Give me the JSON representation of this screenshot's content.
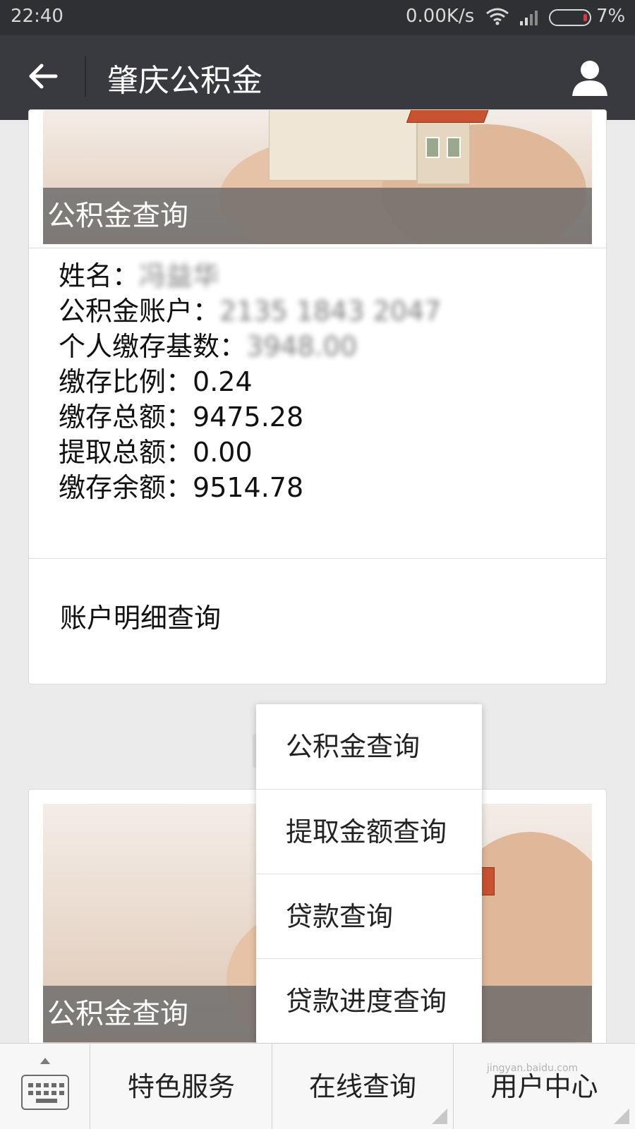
{
  "status_bar": {
    "time": "22:40",
    "network_speed": "0.00K/s",
    "battery_percent": "7%",
    "battery_level": 0.07,
    "wifi_icon": "wifi-icon",
    "signal_icon": "cellular-signal-icon"
  },
  "header": {
    "title": "肇庆公积金",
    "back_icon": "back-arrow-icon",
    "profile_icon": "user-profile-icon"
  },
  "card1": {
    "banner_caption": "公积金查询",
    "info_rows": [
      {
        "label": "姓名：",
        "value": "冯益华"
      },
      {
        "label": "公积金账户：",
        "value": "2135 1843 2047"
      },
      {
        "label": "个人缴存基数：",
        "value": "3948.00"
      },
      {
        "label": "缴存比例：",
        "value": "0.24"
      },
      {
        "label": "缴存总额：",
        "value": "9475.28"
      },
      {
        "label": "提取总额：",
        "value": "0.00"
      },
      {
        "label": "缴存余额：",
        "value": "9514.78"
      }
    ],
    "detail_link": "账户明细查询"
  },
  "card2": {
    "banner_caption": "公积金查询"
  },
  "popup_menu": {
    "items": [
      "公积金查询",
      "提取金额查询",
      "贷款查询",
      "贷款进度查询"
    ]
  },
  "bottom_bar": {
    "keyboard_icon": "keyboard-icon",
    "menus": [
      "特色服务",
      "在线查询",
      "用户中心"
    ]
  },
  "watermark": "jingyan.baidu.com",
  "colors": {
    "header_bg": "#393a3f",
    "status_bg": "#2e3033",
    "page_bg": "#ebebeb",
    "caption_bg": "#696969"
  }
}
